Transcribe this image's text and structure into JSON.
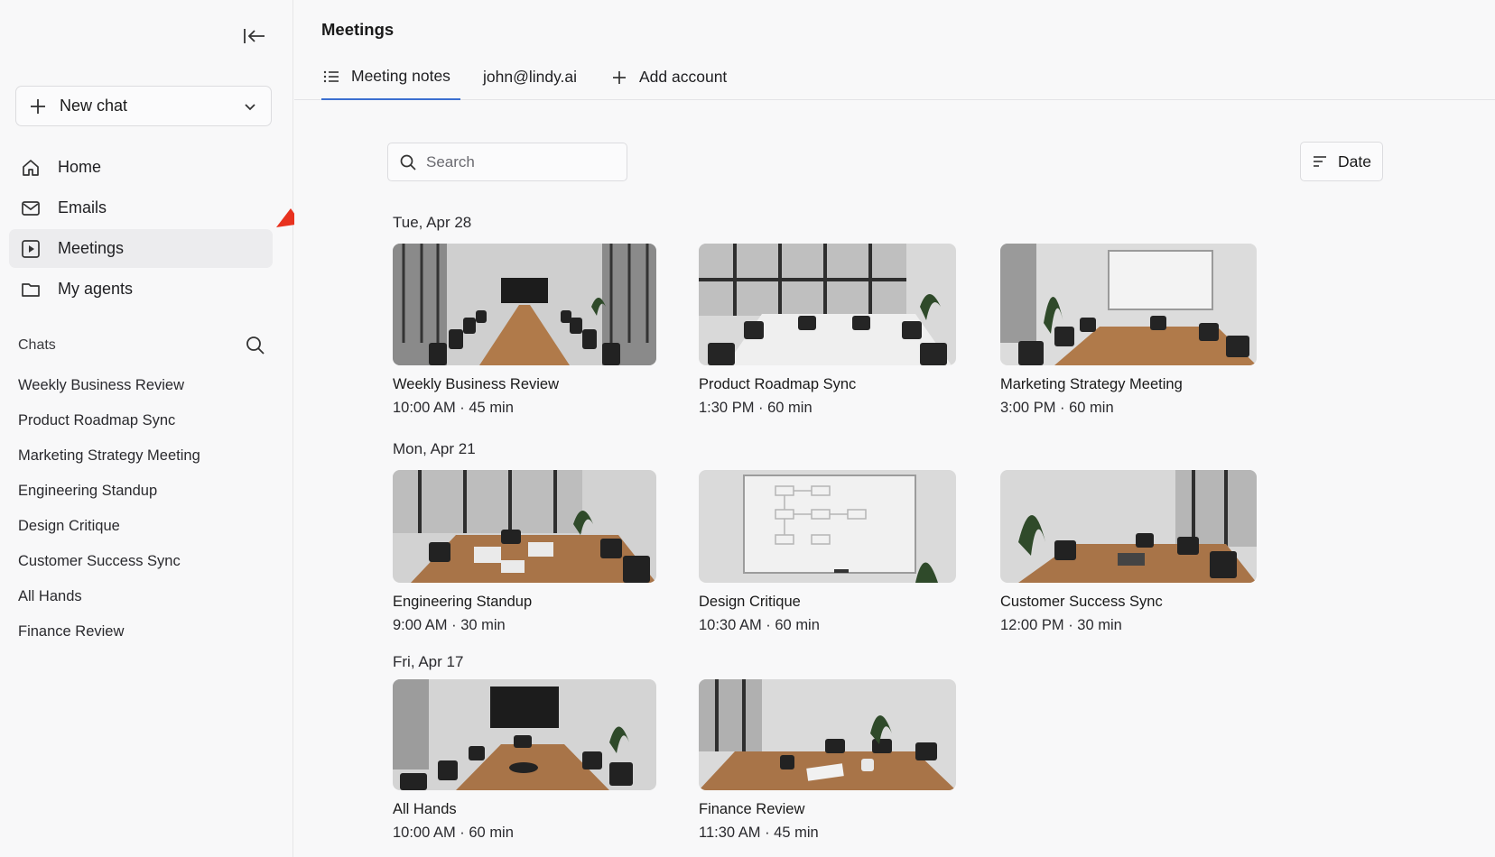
{
  "sidebar": {
    "new_chat_label": "New chat",
    "nav": [
      {
        "label": "Home",
        "icon": "home-icon"
      },
      {
        "label": "Emails",
        "icon": "mail-icon"
      },
      {
        "label": "Meetings",
        "icon": "play-square-icon",
        "active": true
      },
      {
        "label": "My agents",
        "icon": "folder-icon"
      }
    ],
    "chats_label": "Chats",
    "chats": [
      "Weekly Business Review",
      "Product Roadmap Sync",
      "Marketing Strategy Meeting",
      "Engineering Standup",
      "Design Critique",
      "Customer Success Sync",
      "All Hands",
      "Finance Review"
    ]
  },
  "header": {
    "title": "Meetings",
    "tabs": [
      {
        "label": "Meeting notes",
        "icon": "list-icon",
        "active": true
      },
      {
        "label": "john@lindy.ai"
      },
      {
        "label": "Add account",
        "icon": "plus-icon"
      }
    ]
  },
  "toolbar": {
    "search_placeholder": "Search",
    "sort_label": "Date"
  },
  "groups": [
    {
      "date": "Tue, Apr 28",
      "meetings": [
        {
          "title": "Weekly Business Review",
          "time": "10:00 AM · 45 min",
          "scene": "tv-room"
        },
        {
          "title": "Product Roadmap Sync",
          "time": "1:30 PM · 60 min",
          "scene": "window-room"
        },
        {
          "title": "Marketing Strategy Meeting",
          "time": "3:00 PM · 60 min",
          "scene": "whiteboard-room"
        }
      ]
    },
    {
      "date": "Mon, Apr 21",
      "meetings": [
        {
          "title": "Engineering Standup",
          "time": "9:00 AM · 30 min",
          "scene": "laptop-room"
        },
        {
          "title": "Design Critique",
          "time": "10:30 AM · 60 min",
          "scene": "diagram-whiteboard"
        },
        {
          "title": "Customer Success Sync",
          "time": "12:00 PM · 30 min",
          "scene": "plant-room"
        }
      ]
    },
    {
      "date": "Fri, Apr 17",
      "meetings": [
        {
          "title": "All Hands",
          "time": "10:00 AM · 60 min",
          "scene": "tv-room"
        },
        {
          "title": "Finance Review",
          "time": "11:30 AM · 45 min",
          "scene": "notebook-room"
        }
      ]
    }
  ],
  "colors": {
    "accent": "#3b6fd0",
    "annotation_arrow": "#e8321f",
    "table_wood": "#b07a4a"
  }
}
